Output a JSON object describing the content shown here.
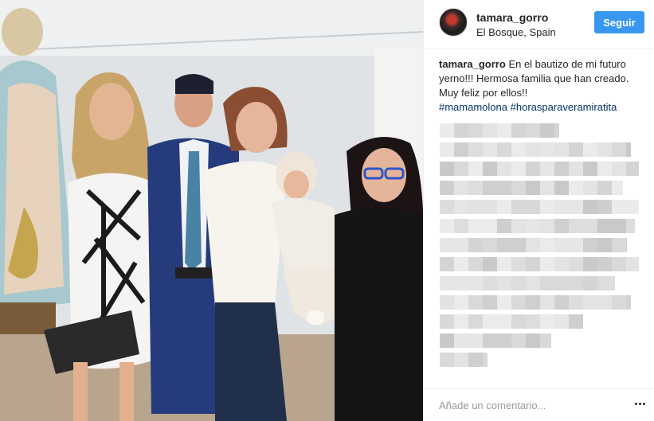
{
  "post": {
    "username": "tamara_gorro",
    "location": "El Bosque, Spain",
    "follow_label": "Seguir",
    "caption": {
      "username": "tamara_gorro",
      "text": "En el bautizo de mi futuro yerno!!! Hermosa familia que han creado. Muy feliz por ellos!!",
      "hashtags": [
        "#mamamolona",
        "#horasparaveramiratita"
      ]
    }
  },
  "comment_box": {
    "placeholder": "Añade un comentario..."
  },
  "icons": {
    "more": "ellipsis-icon",
    "avatar": "profile-avatar"
  },
  "colors": {
    "follow_button": "#3897f0",
    "hashtag": "#003569",
    "border": "#efefef"
  }
}
